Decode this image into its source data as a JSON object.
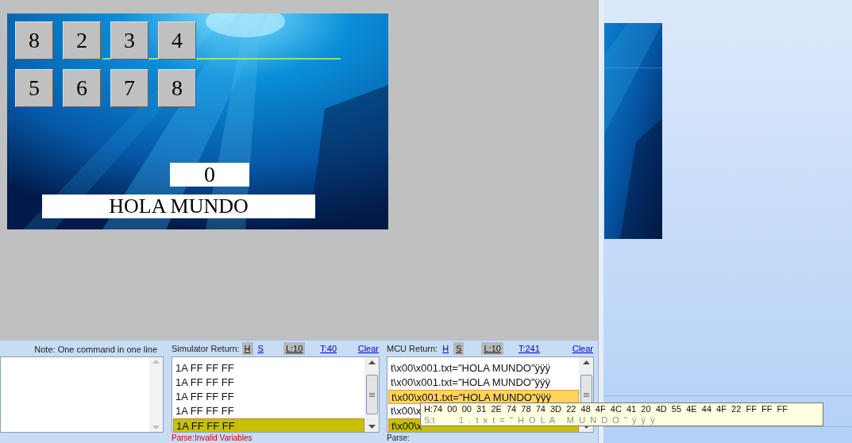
{
  "display": {
    "buttons": [
      {
        "label": "8"
      },
      {
        "label": "2"
      },
      {
        "label": "3"
      },
      {
        "label": "4"
      },
      {
        "label": "5"
      },
      {
        "label": "6"
      },
      {
        "label": "7"
      },
      {
        "label": "8"
      }
    ],
    "number_field": "0",
    "text_field": "HOLA MUNDO"
  },
  "command_panel": {
    "note": "Note: One command in one line"
  },
  "simulator_return": {
    "title": "Simulator Return:",
    "toggles": [
      {
        "label": "H",
        "pressed": true
      },
      {
        "label": "S",
        "pressed": false
      }
    ],
    "line_limit": {
      "label": "L:10",
      "pressed": true
    },
    "count": "T:40",
    "clear": "Clear",
    "rows": [
      {
        "text": "1A FF FF FF",
        "selected": false,
        "hovered": false
      },
      {
        "text": "1A FF FF FF",
        "selected": false,
        "hovered": false
      },
      {
        "text": "1A FF FF FF",
        "selected": false,
        "hovered": false
      },
      {
        "text": "1A FF FF FF",
        "selected": false,
        "hovered": false
      },
      {
        "text": "1A FF FF FF",
        "selected": true,
        "hovered": false
      }
    ],
    "parse": "Parse:Invalid Variables"
  },
  "mcu_return": {
    "title": "MCU Return:",
    "toggles": [
      {
        "label": "H",
        "pressed": false
      },
      {
        "label": "S",
        "pressed": true
      }
    ],
    "line_limit": {
      "label": "L:10",
      "pressed": true
    },
    "count": "T:241",
    "clear": "Clear",
    "rows": [
      {
        "text": "t\\x00\\x001.txt=\"HOLA MUNDO\"ÿÿÿ",
        "selected": false,
        "hovered": false
      },
      {
        "text": "t\\x00\\x001.txt=\"HOLA MUNDO\"ÿÿÿ",
        "selected": false,
        "hovered": false
      },
      {
        "text": "t\\x00\\x001.txt=\"HOLA MUNDO\"ÿÿÿ",
        "selected": false,
        "hovered": true
      },
      {
        "text": "t\\x00\\x",
        "selected": false,
        "hovered": false
      },
      {
        "text": "t\\x00\\x",
        "selected": true,
        "hovered": false
      }
    ],
    "parse": "Parse:"
  },
  "tooltip": {
    "hex": "H:74  00  00  31  2E  74  78  74  3D  22  48  4F  4C  41  20  4D  55  4E  44  4F  22  FF  FF  FF",
    "string": "S:t          1  .  t  x  t  =  \"  H  O  L  A     M  U  N  D  O  \"  ÿ  ÿ  ÿ"
  }
}
